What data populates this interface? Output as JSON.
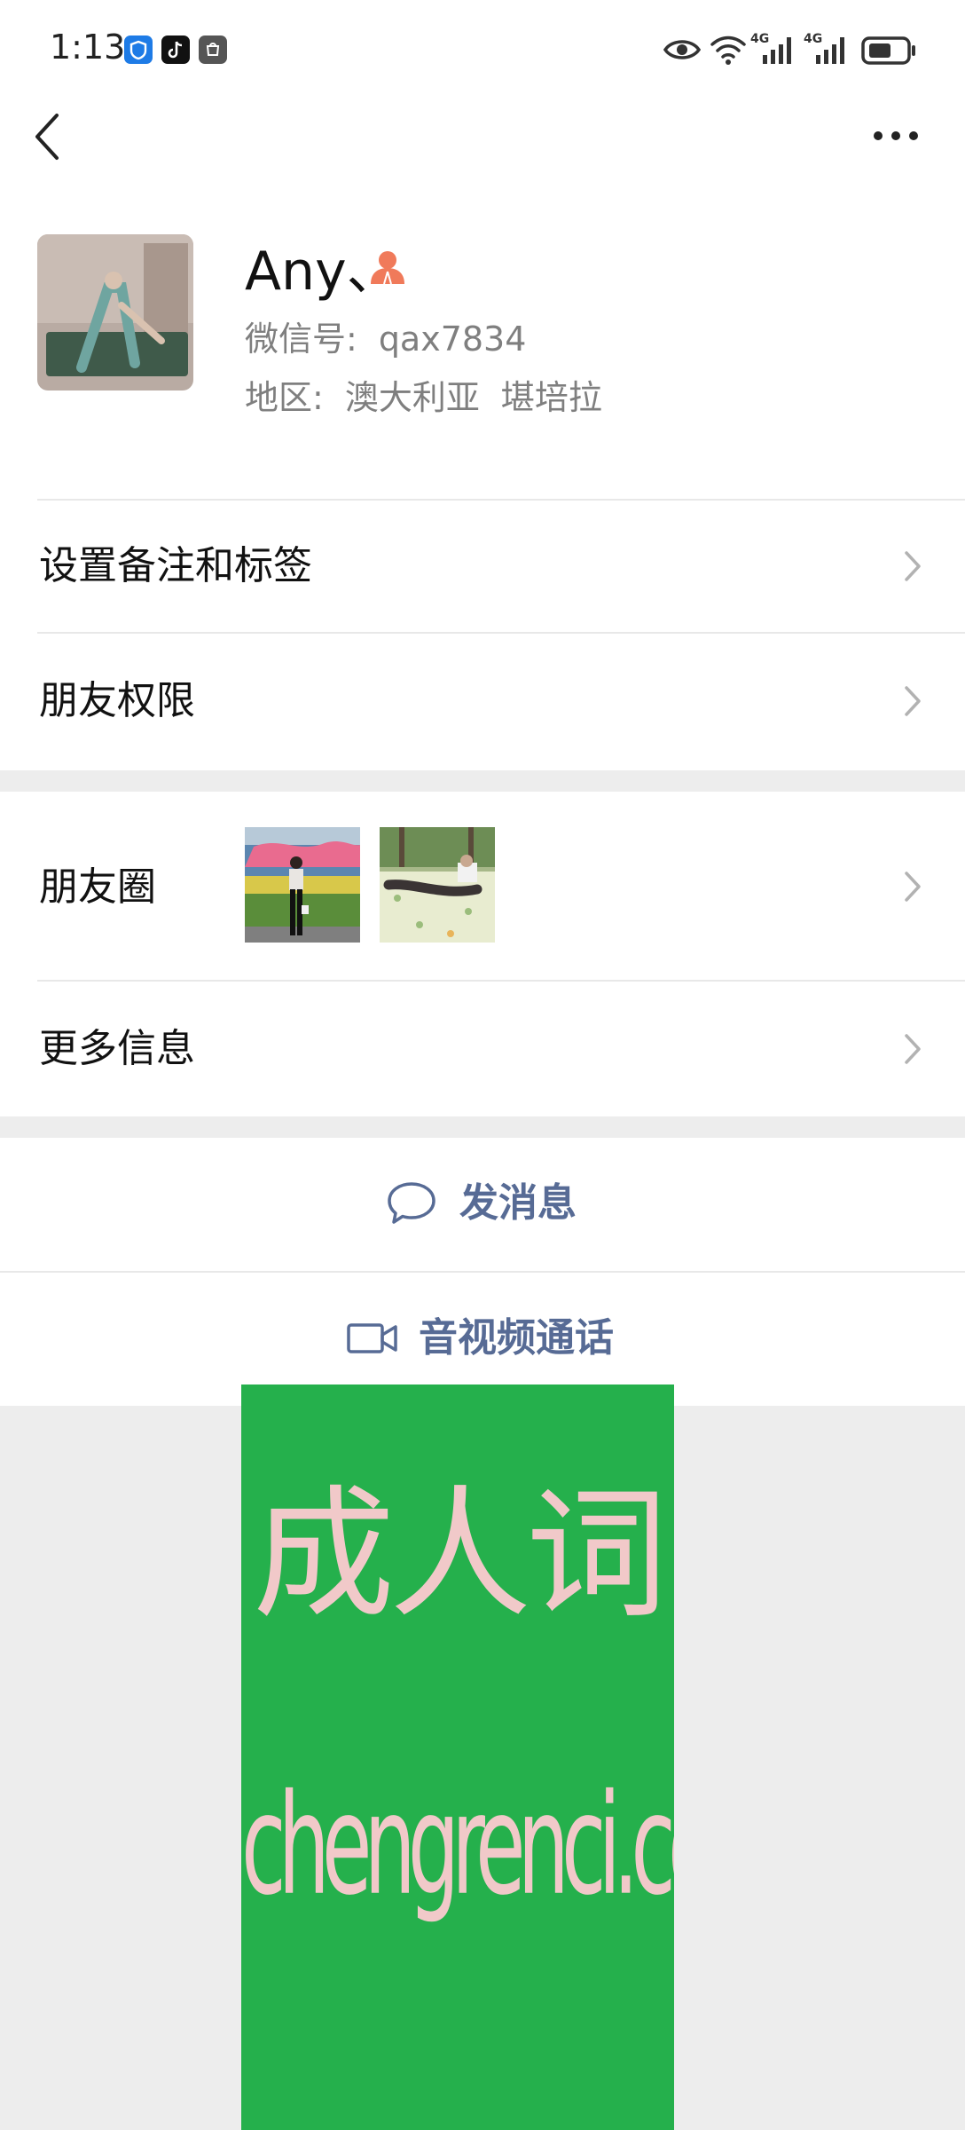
{
  "status_bar": {
    "time": "1:13",
    "app_icons": [
      "shield-app-icon",
      "tiktok-app-icon",
      "huawei-app-icon"
    ],
    "right_icons": [
      "eye-icon",
      "wifi-icon",
      "4g-signal-icon",
      "4g-signal-icon",
      "battery-icon"
    ],
    "network_label_1": "4G",
    "network_label_2": "4G"
  },
  "nav": {
    "back_icon": "chevron-left-icon",
    "more_icon": "more-horizontal-icon"
  },
  "profile": {
    "name": "Any、",
    "gender_icon": "female-icon",
    "gender_color": "#f07a5a",
    "wechat_id_label": "微信号:",
    "wechat_id": "qax7834",
    "region_label": "地区:",
    "region_country": "澳大利亚",
    "region_city": "堪培拉"
  },
  "menu": {
    "remark_tags": "设置备注和标签",
    "friend_permissions": "朋友权限",
    "moments": "朋友圈",
    "more_info": "更多信息"
  },
  "actions": {
    "send_message": "发消息",
    "av_call": "音视频通话",
    "accent_color": "#576b95"
  },
  "banner": {
    "line1": "成人词",
    "line2": "chengrenci.com",
    "bg_color": "#25b04c"
  }
}
